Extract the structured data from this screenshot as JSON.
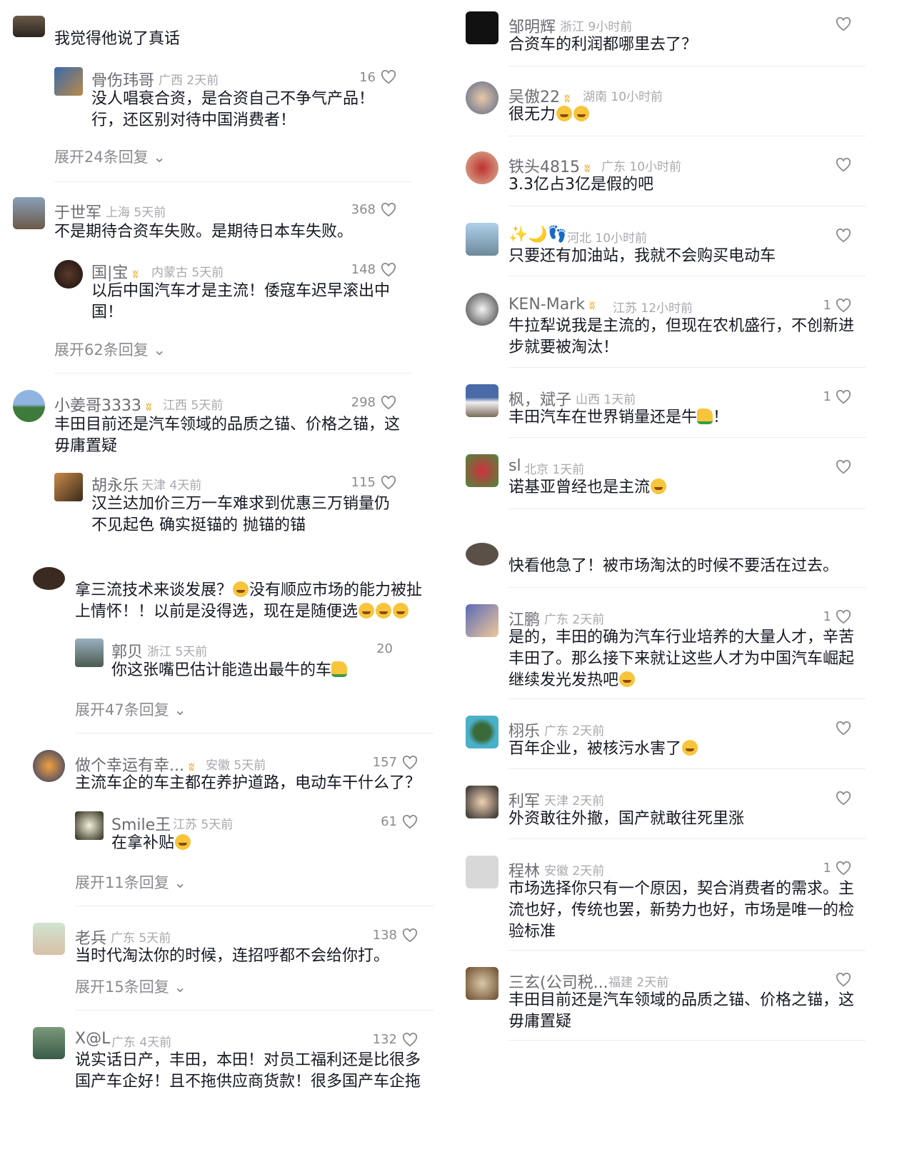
{
  "left": {
    "top_fragment": {
      "text": "我觉得他说了真话"
    },
    "c1": {
      "name": "骨伤玮哥",
      "loc": "广西",
      "time": "2天前",
      "likes": "16",
      "text": "没人唱衰合资，是合资自己不争气产品！行，还区别对待中国消费者！",
      "expand": "展开24条回复"
    },
    "c2": {
      "name": "于世军",
      "loc": "上海",
      "time": "5天前",
      "likes": "368",
      "text": "不是期待合资车失败。是期待日本车失败。"
    },
    "c2r": {
      "name": "国|宝",
      "loc": "内蒙古",
      "time": "5天前",
      "likes": "148",
      "text": "以后中国汽车才是主流！倭寇车迟早滚出中国！",
      "expand": "展开62条回复"
    },
    "c3": {
      "name": "小姜哥3333",
      "loc": "江西",
      "time": "5天前",
      "likes": "298",
      "text": "丰田目前还是汽车领域的品质之锚、价格之锚，这毋庸置疑"
    },
    "c3r": {
      "name": "胡永乐",
      "loc": "天津",
      "time": "4天前",
      "likes": "115",
      "text": "汉兰达加价三万一车难求到优惠三万销量仍不见起色  确实挺锚的  抛锚的锚"
    },
    "c4": {
      "text1": "拿三流技术来谈发展？",
      "text2": "没有顺应市场的能力被扯上情怀！！以前是没得选，现在是随便选"
    },
    "c4r": {
      "name": "郭贝",
      "loc": "浙江",
      "time": "5天前",
      "likes": "20",
      "text": "你这张嘴巴估计能造出最牛的车",
      "expand": "展开47条回复"
    },
    "c5": {
      "name": "做个幸运有幸...",
      "loc": "安徽",
      "time": "5天前",
      "likes": "157",
      "text": "主流车企的车主都在养护道路，电动车干什么了？"
    },
    "c5r": {
      "name": "Smile王",
      "loc": "江苏",
      "time": "5天前",
      "likes": "61",
      "text": "在拿补贴",
      "expand": "展开11条回复"
    },
    "c6": {
      "name": "老兵",
      "loc": "广东",
      "time": "5天前",
      "likes": "138",
      "text": "当时代淘汰你的时候，连招呼都不会给你打。",
      "expand": "展开15条回复"
    },
    "c7": {
      "name": "X@L",
      "loc": "广东",
      "time": "4天前",
      "likes": "132",
      "text": "说实话日产，丰田，本田！对员工福利还是比很多国产车企好！且不拖供应商货款！很多国产车企拖"
    }
  },
  "right": {
    "r1": {
      "name": "邹明辉",
      "loc": "浙江",
      "time": "9小时前",
      "text": "合资车的利润都哪里去了？"
    },
    "r2": {
      "name": "吴傲22",
      "loc": "湖南",
      "time": "10小时前",
      "text": "很无力"
    },
    "r3": {
      "name": "铁头4815",
      "loc": "广东",
      "time": "10小时前",
      "text": "3.3亿占3亿是假的吧"
    },
    "r4": {
      "name": "✨🌙👣",
      "loc": "河北",
      "time": "10小时前",
      "text": "只要还有加油站，我就不会购买电动车"
    },
    "r5": {
      "name": "KEN-Mark",
      "loc": "江苏",
      "time": "12小时前",
      "likes": "1",
      "text": "牛拉犁说我是主流的，但现在农机盛行，不创新进步就要被淘汰！"
    },
    "r6": {
      "name": "枫，斌子",
      "loc": "山西",
      "time": "1天前",
      "likes": "1",
      "text": "丰田汽车在世界销量还是牛",
      "text_tail": "！"
    },
    "r7": {
      "name": "sl",
      "loc": "北京",
      "time": "1天前",
      "text": "诺基亚曾经也是主流"
    },
    "r8": {
      "text": "快看他急了！被市场淘汰的时候不要活在过去。"
    },
    "r9": {
      "name": "江鹏",
      "loc": "广东",
      "time": "2天前",
      "likes": "1",
      "text": "是的，丰田的确为汽车行业培养的大量人才，辛苦丰田了。那么接下来就让这些人才为中国汽车崛起继续发光发热吧"
    },
    "r10": {
      "name": "栩乐",
      "loc": "广东",
      "time": "2天前",
      "text": "百年企业，被核污水害了"
    },
    "r11": {
      "name": "利军",
      "loc": "天津",
      "time": "2天前",
      "text": "外资敢往外撤，国产就敢往死里涨"
    },
    "r12": {
      "name": "程林",
      "loc": "安徽",
      "time": "2天前",
      "likes": "1",
      "text": "市场选择你只有一个原因，契合消费者的需求。主流也好，传统也罢，新势力也好，市场是唯一的检验标准"
    },
    "r13": {
      "name": "三玄(公司税...",
      "loc": "福建",
      "time": "2天前",
      "text": "丰田目前还是汽车领域的品质之锚、价格之锚，这毋庸置疑"
    }
  },
  "icons": {
    "heart": "heart-outline-icon",
    "chevron": "chevron-down-icon",
    "badge": "creator-badge-icon"
  },
  "colors": {
    "text": "#161823",
    "meta": "#a8a8ae",
    "badge": "#f3a21b",
    "divider": "#ececef"
  }
}
